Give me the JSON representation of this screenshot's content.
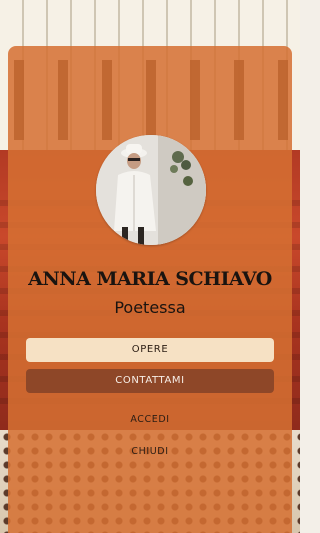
{
  "profile": {
    "name": "ANNA MARIA SCHIAVO",
    "role": "Poetessa",
    "avatar_icon": "portrait-photo"
  },
  "actions": {
    "primary_label": "OPERE",
    "secondary_label": "CONTATTAMI",
    "login_label": "ACCEDI",
    "close_label": "CHIUDI"
  },
  "colors": {
    "card_overlay": "#d57032",
    "primary_button": "#f6e1c4",
    "secondary_button": "#8e4728",
    "text_dark": "#1a1410"
  }
}
